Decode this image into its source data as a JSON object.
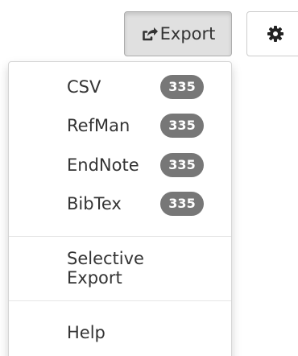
{
  "toolbar": {
    "export_label": "Export",
    "export_icon": "share-square-icon",
    "settings_icon": "gear-icon"
  },
  "export_menu": {
    "formats": [
      {
        "label": "CSV",
        "count": "335"
      },
      {
        "label": "RefMan",
        "count": "335"
      },
      {
        "label": "EndNote",
        "count": "335"
      },
      {
        "label": "BibTex",
        "count": "335"
      }
    ],
    "selective_export_label": "Selective Export",
    "help_label": "Help"
  },
  "colors": {
    "badge_bg": "#777777",
    "active_button_bg": "#e0e0e0"
  }
}
